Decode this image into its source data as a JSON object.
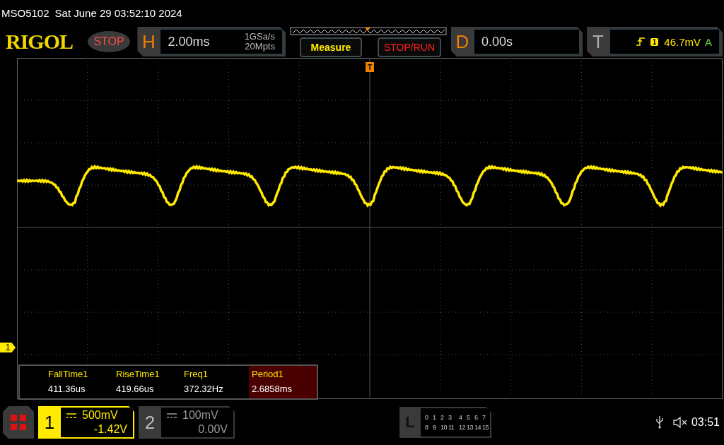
{
  "status_line": {
    "model": "MSO5102",
    "datetime": "Sat June 29 03:52:10 2024"
  },
  "header": {
    "logo": "RIGOL",
    "run_state": {
      "label": "STOP",
      "kind": "stopped"
    },
    "horizontal": {
      "label": "H",
      "timebase": "2.00ms",
      "sample_rate": "1GSa/s",
      "memory_depth": "20Mpts"
    },
    "buttons": [
      {
        "label": "Measure",
        "kind": "measure"
      },
      {
        "label": "STOP/RUN",
        "kind": "run"
      }
    ],
    "delay": {
      "label": "D",
      "value": "0.00s"
    },
    "trigger": {
      "label": "T",
      "source": "1",
      "level": "46.7mV",
      "mode": "A"
    }
  },
  "screen": {
    "trigger_marker": "T",
    "channel_marker": "1"
  },
  "measurements": [
    {
      "name": "FallTime1",
      "value": "411.36us",
      "selected": false
    },
    {
      "name": "RiseTime1",
      "value": "419.66us",
      "selected": false
    },
    {
      "name": "Freq1",
      "value": "372.32Hz",
      "selected": false
    },
    {
      "name": "Period1",
      "value": "2.6858ms",
      "selected": true
    }
  ],
  "bottom": {
    "channels": [
      {
        "number": "1",
        "scale": "500mV",
        "offset": "-1.42V",
        "active": true
      },
      {
        "number": "2",
        "scale": "100mV",
        "offset": "0.00V",
        "active": false
      }
    ],
    "logic": {
      "label": "L",
      "rows": [
        [
          "0",
          "1",
          "2",
          "3",
          "4",
          "5",
          "6",
          "7"
        ],
        [
          "8",
          "9",
          "10",
          "11",
          "12",
          "13",
          "14",
          "15"
        ]
      ]
    },
    "time": "03:51"
  }
}
